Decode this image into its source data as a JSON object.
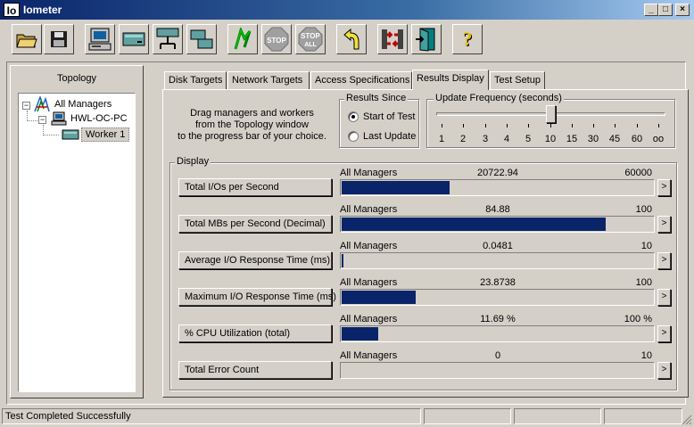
{
  "window": {
    "icon_text": "Io",
    "title": "Iometer",
    "min_label": "_",
    "max_label": "□",
    "close_label": "×"
  },
  "toolbar": {
    "buttons": [
      {
        "name": "open-config-button",
        "icon": "open-folder-icon"
      },
      {
        "name": "save-config-button",
        "icon": "floppy-disk-icon"
      },
      {
        "name": "show-results-button",
        "icon": "computer-icon"
      },
      {
        "name": "new-disk-worker-button",
        "icon": "disk-worker-icon"
      },
      {
        "name": "new-network-worker-button",
        "icon": "network-worker-icon"
      },
      {
        "name": "duplicate-worker-button",
        "icon": "duplicate-worker-icon"
      },
      {
        "name": "start-tests-button",
        "icon": "green-flag-icon"
      },
      {
        "name": "stop-button",
        "icon": "stop-sign-icon",
        "label": "STOP"
      },
      {
        "name": "stop-all-button",
        "icon": "stop-all-sign-icon",
        "label": "STOP",
        "label2": "ALL"
      },
      {
        "name": "reset-workers-button",
        "icon": "back-arrow-icon"
      },
      {
        "name": "disconnect-button",
        "icon": "disconnect-icon"
      },
      {
        "name": "exit-button",
        "icon": "exit-door-icon"
      },
      {
        "name": "about-button",
        "icon": "question-mark-icon",
        "label": "?"
      }
    ]
  },
  "topology": {
    "title": "Topology",
    "items": [
      {
        "label": "All Managers",
        "expander": "−"
      },
      {
        "label": "HWL-OC-PC",
        "expander": "−"
      },
      {
        "label": "Worker 1"
      }
    ]
  },
  "tabs": [
    {
      "label": "Disk Targets"
    },
    {
      "label": "Network Targets"
    },
    {
      "label": "Access Specifications"
    },
    {
      "label": "Results Display"
    },
    {
      "label": "Test Setup"
    }
  ],
  "results": {
    "instructions": [
      "Drag managers and workers",
      "from the Topology window",
      "to the progress bar of your choice."
    ],
    "results_since": {
      "title": "Results Since",
      "options": [
        {
          "label": "Start of Test",
          "selected": true
        },
        {
          "label": "Last Update",
          "selected": false
        }
      ]
    },
    "update_frequency": {
      "title": "Update Frequency (seconds)",
      "ticks": [
        "1",
        "2",
        "3",
        "4",
        "5",
        "10",
        "15",
        "30",
        "45",
        "60",
        "oo"
      ],
      "selected_index": 5
    },
    "display_title": "Display",
    "metrics": [
      {
        "label": "Total I/Os per Second",
        "source": "All Managers",
        "value": "20722.94",
        "max": "60000",
        "fraction": 0.3454,
        "arrow": ">"
      },
      {
        "label": "Total MBs per Second (Decimal)",
        "source": "All Managers",
        "value": "84.88",
        "max": "100",
        "fraction": 0.8488,
        "arrow": ">"
      },
      {
        "label": "Average I/O Response Time (ms)",
        "source": "All Managers",
        "value": "0.0481",
        "max": "10",
        "fraction": 0.0048,
        "arrow": ">"
      },
      {
        "label": "Maximum I/O Response Time (ms)",
        "source": "All Managers",
        "value": "23.8738",
        "max": "100",
        "fraction": 0.2387,
        "arrow": ">"
      },
      {
        "label": "% CPU Utilization (total)",
        "source": "All Managers",
        "value": "11.69 %",
        "max": "100 %",
        "fraction": 0.1169,
        "arrow": ">"
      },
      {
        "label": "Total Error Count",
        "source": "All Managers",
        "value": "0",
        "max": "10",
        "fraction": 0,
        "arrow": ">"
      }
    ]
  },
  "status_bar": {
    "message": "Test Completed Successfully"
  },
  "colors": {
    "bar_fill": "#0a246a",
    "title_bar": "#0a246a",
    "face": "#d4d0c8"
  }
}
